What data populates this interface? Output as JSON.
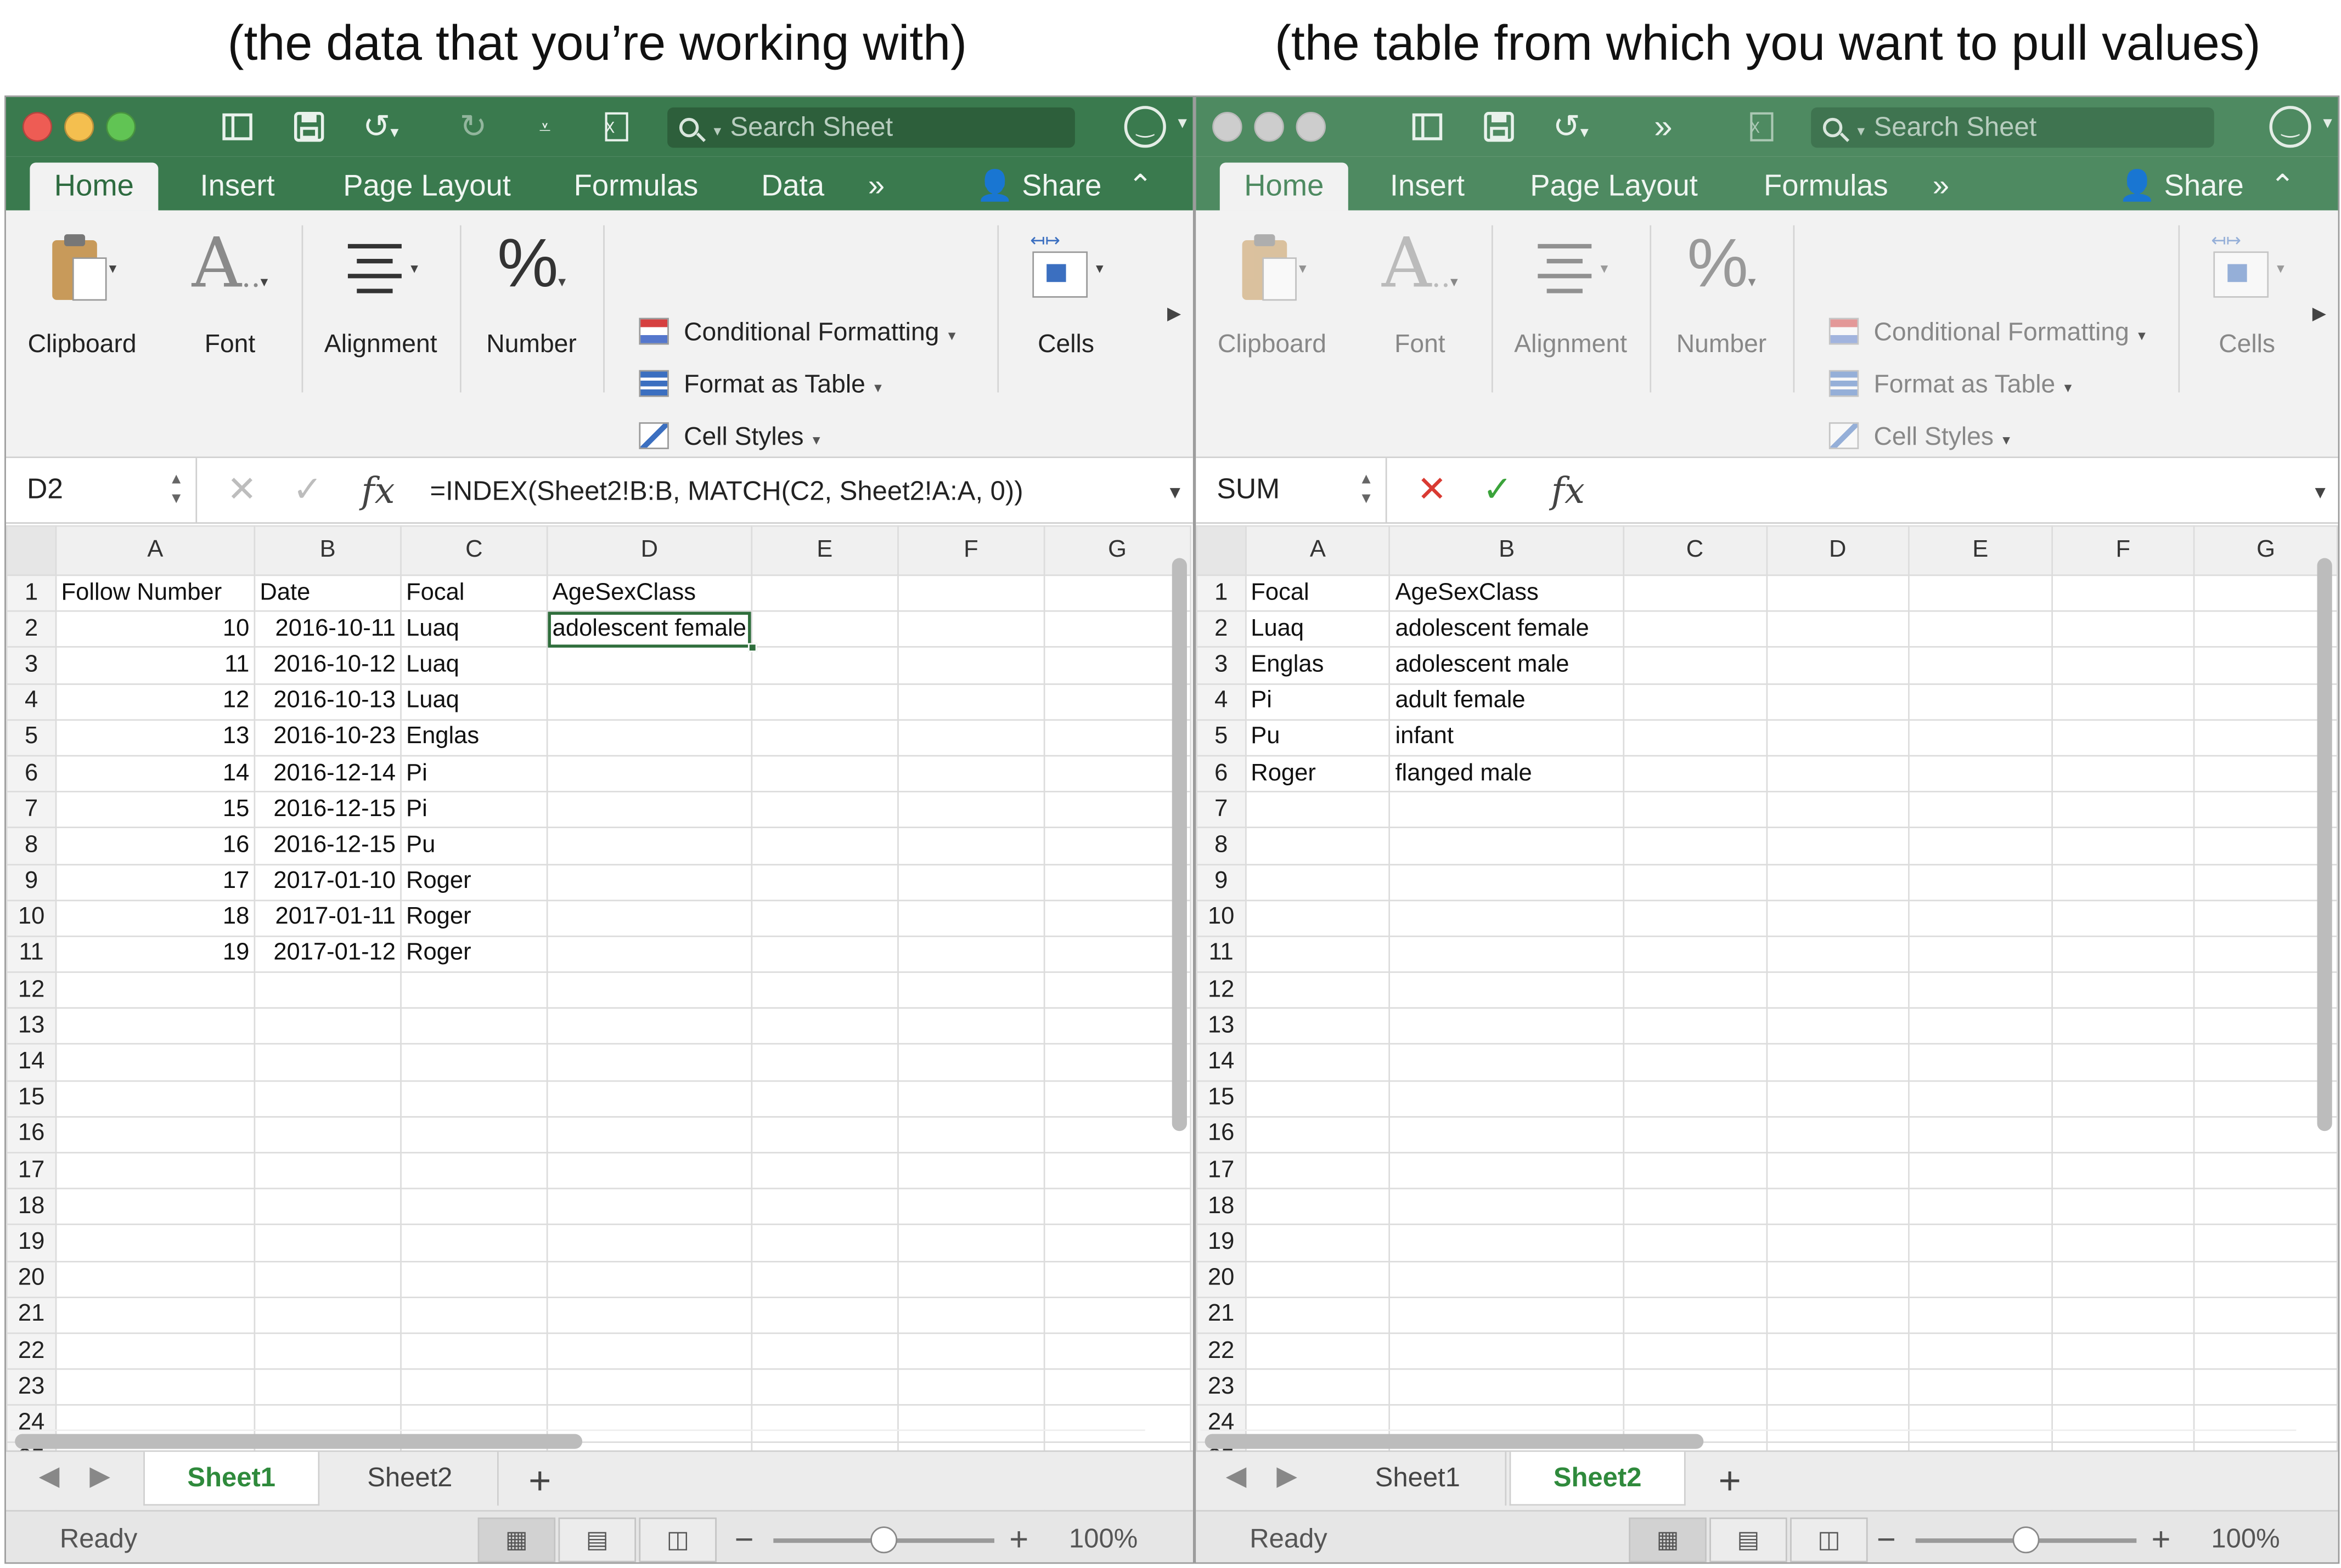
{
  "captions": {
    "left": "(the data that you’re working with)",
    "right": "(the table from which you want to pull values)"
  },
  "colors": {
    "title_green": "#3a7a4e",
    "accent": "#2f6e3c",
    "cancel_red": "#d93a32",
    "confirm_green": "#3aa33a"
  },
  "window1": {
    "search_placeholder": "Search Sheet",
    "ribbon_tabs": [
      "Home",
      "Insert",
      "Page Layout",
      "Formulas",
      "Data"
    ],
    "share_label": "Share",
    "ribbon_groups": {
      "clipboard": "Clipboard",
      "font": "Font",
      "alignment": "Alignment",
      "number": "Number",
      "cells": "Cells"
    },
    "ribbon_cmds": {
      "conditional": "Conditional Formatting",
      "format_table": "Format as Table",
      "cell_styles": "Cell Styles"
    },
    "name_box": "D2",
    "formula": "=INDEX(Sheet2!B:B, MATCH(C2, Sheet2!A:A, 0))",
    "columns": [
      "A",
      "B",
      "C",
      "D",
      "E",
      "F",
      "G"
    ],
    "rows": [
      [
        "Follow Number",
        "Date",
        "Focal",
        "AgeSexClass",
        "",
        "",
        ""
      ],
      [
        "10",
        "2016-10-11",
        "Luaq",
        "adolescent female",
        "",
        "",
        ""
      ],
      [
        "11",
        "2016-10-12",
        "Luaq",
        "",
        "",
        "",
        ""
      ],
      [
        "12",
        "2016-10-13",
        "Luaq",
        "",
        "",
        "",
        ""
      ],
      [
        "13",
        "2016-10-23",
        "Englas",
        "",
        "",
        "",
        ""
      ],
      [
        "14",
        "2016-12-14",
        "Pi",
        "",
        "",
        "",
        ""
      ],
      [
        "15",
        "2016-12-15",
        "Pi",
        "",
        "",
        "",
        ""
      ],
      [
        "16",
        "2016-12-15",
        "Pu",
        "",
        "",
        "",
        ""
      ],
      [
        "17",
        "2017-01-10",
        "Roger",
        "",
        "",
        "",
        ""
      ],
      [
        "18",
        "2017-01-11",
        "Roger",
        "",
        "",
        "",
        ""
      ],
      [
        "19",
        "2017-01-12",
        "Roger",
        "",
        "",
        "",
        ""
      ]
    ],
    "row_count": 26,
    "sheet_tabs": [
      "Sheet1",
      "Sheet2"
    ],
    "active_sheet": "Sheet1",
    "status": "Ready",
    "zoom": "100%"
  },
  "window2": {
    "search_placeholder": "Search Sheet",
    "ribbon_tabs": [
      "Home",
      "Insert",
      "Page Layout",
      "Formulas"
    ],
    "share_label": "Share",
    "ribbon_groups": {
      "clipboard": "Clipboard",
      "font": "Font",
      "alignment": "Alignment",
      "number": "Number",
      "cells": "Cells"
    },
    "ribbon_cmds": {
      "conditional": "Conditional Formatting",
      "format_table": "Format as Table",
      "cell_styles": "Cell Styles"
    },
    "name_box": "SUM",
    "formula": "",
    "columns": [
      "A",
      "B",
      "C",
      "D",
      "E",
      "F",
      "G"
    ],
    "rows": [
      [
        "Focal",
        "AgeSexClass",
        "",
        "",
        "",
        "",
        ""
      ],
      [
        "Luaq",
        "adolescent female",
        "",
        "",
        "",
        "",
        ""
      ],
      [
        "Englas",
        "adolescent male",
        "",
        "",
        "",
        "",
        ""
      ],
      [
        "Pi",
        "adult female",
        "",
        "",
        "",
        "",
        ""
      ],
      [
        "Pu",
        "infant",
        "",
        "",
        "",
        "",
        ""
      ],
      [
        "Roger",
        "flanged male",
        "",
        "",
        "",
        "",
        ""
      ]
    ],
    "row_count": 26,
    "sheet_tabs": [
      "Sheet1",
      "Sheet2"
    ],
    "active_sheet": "Sheet2",
    "status": "Ready",
    "zoom": "100%"
  }
}
